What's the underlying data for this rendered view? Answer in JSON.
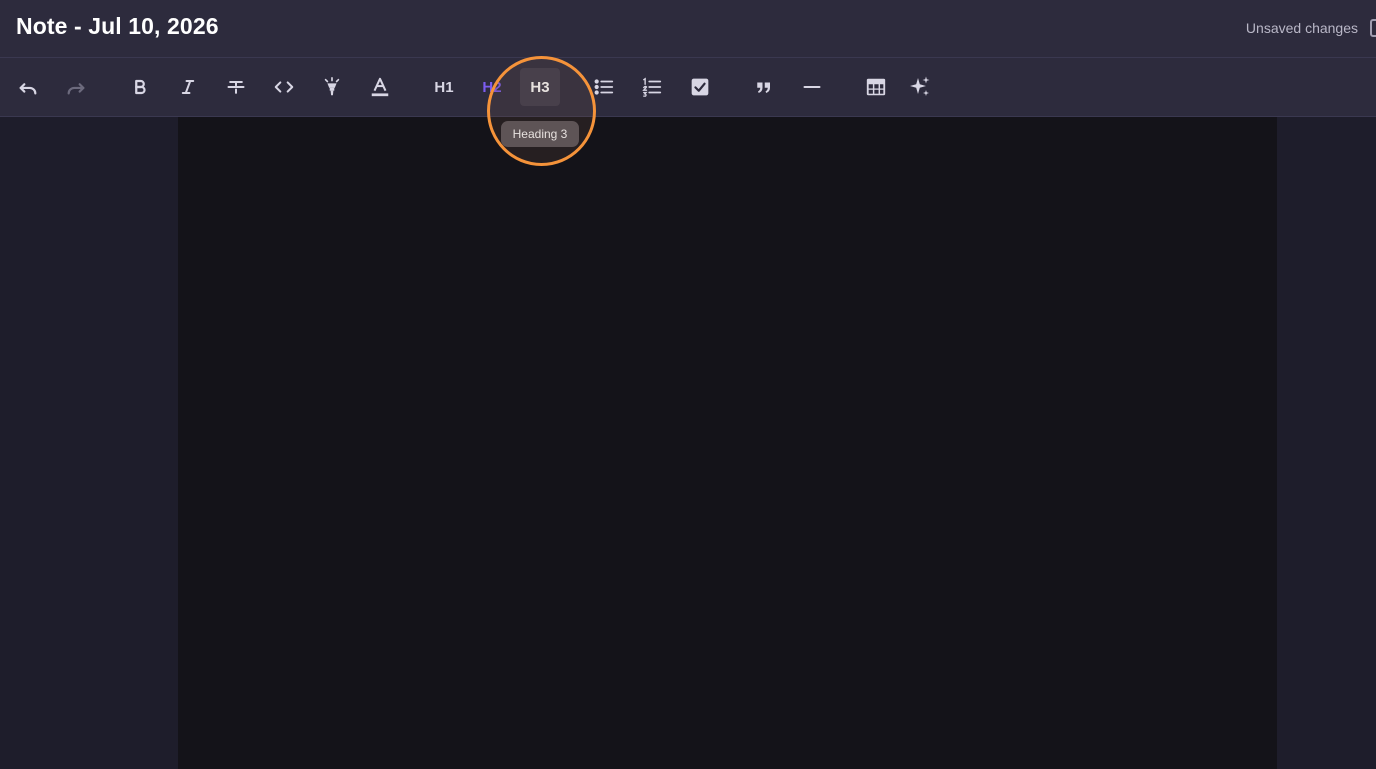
{
  "header": {
    "title": "Note - Jul 10, 2026",
    "status": "Unsaved changes"
  },
  "toolbar": {
    "h1_label": "H1",
    "h2_label": "H2",
    "h3_label": "H3",
    "buttons": [
      {
        "name": "undo",
        "icon": "undo-icon",
        "enabled": true
      },
      {
        "name": "redo",
        "icon": "redo-icon",
        "enabled": false
      },
      {
        "name": "bold",
        "icon": "bold-icon"
      },
      {
        "name": "italic",
        "icon": "italic-icon"
      },
      {
        "name": "strikethrough",
        "icon": "strikethrough-icon"
      },
      {
        "name": "code",
        "icon": "code-icon"
      },
      {
        "name": "highlight",
        "icon": "highlighter-icon"
      },
      {
        "name": "text-color",
        "icon": "text-color-icon"
      },
      {
        "name": "heading-1",
        "label": "H1"
      },
      {
        "name": "heading-2",
        "label": "H2",
        "active_color": "#7b5cf0"
      },
      {
        "name": "heading-3",
        "label": "H3",
        "hovered": true
      },
      {
        "name": "bullet-list",
        "icon": "bullet-list-icon"
      },
      {
        "name": "numbered-list",
        "icon": "numbered-list-icon"
      },
      {
        "name": "checklist",
        "icon": "checkbox-icon"
      },
      {
        "name": "blockquote",
        "icon": "quote-icon"
      },
      {
        "name": "horizontal-rule",
        "icon": "horizontal-rule-icon"
      },
      {
        "name": "table",
        "icon": "table-icon"
      },
      {
        "name": "ai-assist",
        "icon": "sparkles-icon"
      }
    ]
  },
  "tooltip": {
    "text": "Heading 3"
  },
  "colors": {
    "accent": "#7b5cf0",
    "highlight_ring": "#f5933a",
    "toolbar_bg": "#2d2b3d",
    "editor_bg": "#141319",
    "page_bg": "#1e1d2b"
  }
}
